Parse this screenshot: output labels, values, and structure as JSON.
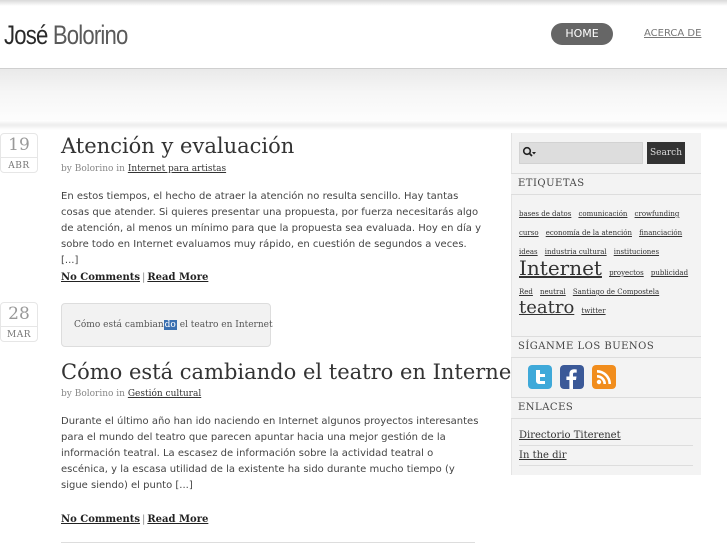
{
  "site": {
    "logo_first": "José",
    "logo_last": "Bolorino"
  },
  "nav": {
    "home": "HOME",
    "about": "ACERCA DE"
  },
  "posts": [
    {
      "day": "19",
      "month": "ABR",
      "title": "Atención y evaluación",
      "by_prefix": "by Bolorino in",
      "category": "Internet para artistas",
      "excerpt": "En estos tiempos, el hecho de atraer la atención no resulta sencillo. Hay tantas cosas que atender. Si quieres presentar una propuesta, por fuerza necesitarás algo de atención, al menos un mínimo para que la propuesta sea evaluada. Hoy en día y sobre todo en Internet evaluamos muy rápido, en cuestión de segundos a veces. [...]",
      "comments": "No Comments",
      "separator": "|",
      "read_more": "Read More"
    },
    {
      "day": "28",
      "month": "MAR",
      "quote_before": "Cómo está cambian",
      "quote_selected": "do",
      "quote_after": " el teatro en Internet",
      "title": "Cómo está cambiando el teatro en Internet",
      "by_prefix": "by Bolorino in",
      "category": "Gestión cultural",
      "excerpt": "Durante el último año han ido naciendo en Internet algunos proyectos interesantes para el mundo del teatro que parecen apuntar hacia una mejor gestión de la información teatral. La escasez de información sobre la actividad teatral o escénica, y la escasa utilidad de la existente ha sido durante mucho tiempo (y sigue siendo) el punto [...]",
      "comments": "No Comments",
      "separator": "|",
      "read_more": "Read More"
    }
  ],
  "sidebar": {
    "search_button": "Search",
    "search_placeholder": "",
    "tags_heading": "ETIQUETAS",
    "tags": [
      {
        "label": "bases de datos",
        "size": 7
      },
      {
        "label": "comunicación",
        "size": 7
      },
      {
        "label": "crowfunding",
        "size": 7
      },
      {
        "label": "curso",
        "size": 7
      },
      {
        "label": "economía de la atención",
        "size": 7
      },
      {
        "label": "financiación",
        "size": 7
      },
      {
        "label": "ideas",
        "size": 7
      },
      {
        "label": "industria cultural",
        "size": 7
      },
      {
        "label": "instituciones",
        "size": 7
      },
      {
        "label": "Internet",
        "size": 20
      },
      {
        "label": "proyectos",
        "size": 7
      },
      {
        "label": "publicidad",
        "size": 7
      },
      {
        "label": "Red",
        "size": 7
      },
      {
        "label": "neutral",
        "size": 7
      },
      {
        "label": "Santiago de Compostela",
        "size": 7
      },
      {
        "label": "teatro",
        "size": 18
      },
      {
        "label": "twitter",
        "size": 7
      }
    ],
    "follow_heading": "SÍGANME LOS BUENOS",
    "social": [
      {
        "icon": "twitter-icon",
        "color": "#3fa9d9"
      },
      {
        "icon": "facebook-icon",
        "color": "#3b5998"
      },
      {
        "icon": "rss-icon",
        "color": "#f18d1d"
      }
    ],
    "links_heading": "ENLACES",
    "links": [
      "Directorio Titerenet",
      "In the dir"
    ]
  }
}
